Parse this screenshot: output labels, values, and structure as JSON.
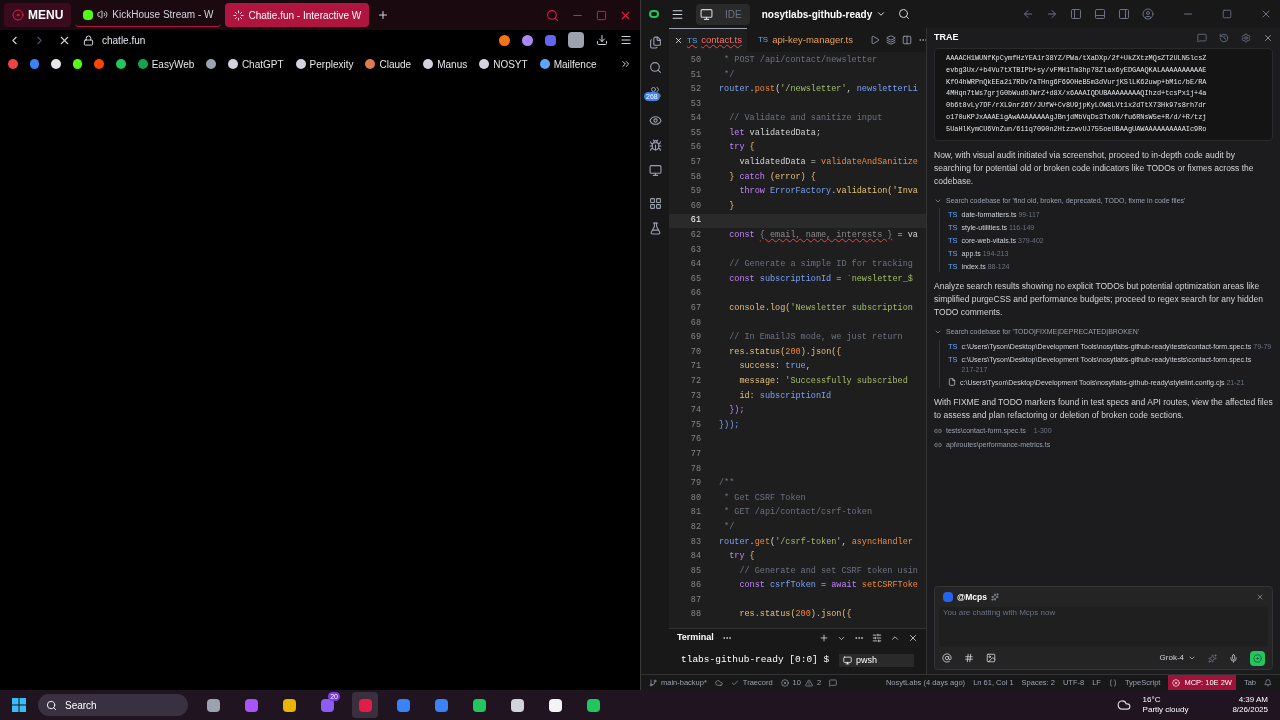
{
  "browser": {
    "menu_label": "MENU",
    "tabs": [
      {
        "title": "KickHouse Stream - W",
        "selected": false,
        "audio": true
      },
      {
        "title": "Chatie.fun - Interactive W",
        "selected": true,
        "audio": false
      }
    ],
    "address": "chatle.fun",
    "bookmarks": [
      {
        "kind": "icon",
        "color": "#ef4444"
      },
      {
        "kind": "icon",
        "color": "#3b82f6"
      },
      {
        "kind": "icon",
        "color": "#e5e7eb"
      },
      {
        "kind": "icon",
        "color": "#53fc18"
      },
      {
        "kind": "icon",
        "color": "#ff4500"
      },
      {
        "kind": "icon",
        "color": "#22c55e"
      },
      {
        "kind": "label",
        "label": "EasyWeb",
        "color": "#16a34a"
      },
      {
        "kind": "icon",
        "color": "#9ca3af"
      },
      {
        "kind": "label",
        "label": "ChatGPT",
        "color": "#d1d5db"
      },
      {
        "kind": "label",
        "label": "Perplexity",
        "color": "#d1d5db"
      },
      {
        "kind": "label",
        "label": "Claude",
        "color": "#e07a4f"
      },
      {
        "kind": "label",
        "label": "Manus",
        "color": "#d1d5db"
      },
      {
        "kind": "label",
        "label": "NOSYT",
        "color": "#d1d5db"
      },
      {
        "kind": "label",
        "label": "Mailfence",
        "color": "#60a5fa"
      }
    ]
  },
  "ide": {
    "mode_label": "IDE",
    "project": "nosytlabs-github-ready",
    "activity_badge": "268",
    "tabs": [
      {
        "badge": "TS",
        "label": "contact.ts",
        "selected": true
      },
      {
        "badge": "TS",
        "label": "api-key-manager.ts",
        "selected": false
      }
    ],
    "code_lines": [
      {
        "number": "50",
        "current": false,
        "tokens": [
          {
            "kind": "comment",
            "t": " * POST /api/contact/newsletter"
          }
        ]
      },
      {
        "number": "51",
        "current": false,
        "tokens": [
          {
            "kind": "comment",
            "t": " */"
          }
        ]
      },
      {
        "number": "52",
        "current": false,
        "tokens": [
          {
            "kind": "variable",
            "t": "router"
          },
          {
            "kind": "plain",
            "t": "."
          },
          {
            "kind": "function",
            "t": "post"
          },
          {
            "kind": "plain",
            "t": "("
          },
          {
            "kind": "string",
            "t": "'/newsletter'"
          },
          {
            "kind": "plain",
            "t": ", "
          },
          {
            "kind": "variable",
            "t": "newsletterLi"
          }
        ]
      },
      {
        "number": "53",
        "current": false
      },
      {
        "number": "54",
        "current": false,
        "tokens": [
          {
            "kind": "comment",
            "t": "  // Validate and sanitize input"
          }
        ]
      },
      {
        "number": "55",
        "current": false,
        "tokens": [
          {
            "kind": "keyword",
            "t": "  let "
          },
          {
            "kind": "plain",
            "t": "validatedData;"
          }
        ]
      },
      {
        "number": "56",
        "current": false,
        "tokens": [
          {
            "kind": "keyword",
            "t": "  try "
          },
          {
            "kind": "punct",
            "t": "{"
          }
        ]
      },
      {
        "number": "57",
        "current": false,
        "tokens": [
          {
            "kind": "plain",
            "t": "    validatedData = "
          },
          {
            "kind": "function",
            "t": "validateAndSanitize"
          }
        ]
      },
      {
        "number": "58",
        "current": false,
        "tokens": [
          {
            "kind": "punct",
            "t": "  } "
          },
          {
            "kind": "keyword",
            "t": "catch "
          },
          {
            "kind": "punct",
            "t": "(error) {"
          }
        ]
      },
      {
        "number": "59",
        "current": false,
        "tokens": [
          {
            "kind": "keyword",
            "t": "    throw "
          },
          {
            "kind": "variable",
            "t": "ErrorFactory"
          },
          {
            "kind": "plain",
            "t": "."
          },
          {
            "kind": "punct",
            "t": "validation('Inva"
          }
        ]
      },
      {
        "number": "60",
        "current": false,
        "tokens": [
          {
            "kind": "punct",
            "t": "  }"
          }
        ]
      },
      {
        "number": "61",
        "current": true
      },
      {
        "number": "62",
        "current": false,
        "tokens": [
          {
            "kind": "keyword",
            "t": "  const "
          },
          {
            "kind": "error",
            "t": "{ email, name, interests }"
          },
          {
            "kind": "plain",
            "t": " = va"
          }
        ]
      },
      {
        "number": "63",
        "current": false
      },
      {
        "number": "64",
        "current": false,
        "tokens": [
          {
            "kind": "comment",
            "t": "  // Generate a simple ID for tracking"
          }
        ]
      },
      {
        "number": "65",
        "current": false,
        "tokens": [
          {
            "kind": "keyword",
            "t": "  const "
          },
          {
            "kind": "variable",
            "t": "subscriptionId"
          },
          {
            "kind": "plain",
            "t": " = "
          },
          {
            "kind": "string",
            "t": "`newsletter_$"
          }
        ]
      },
      {
        "number": "66",
        "current": false
      },
      {
        "number": "67",
        "current": false,
        "tokens": [
          {
            "kind": "punct",
            "t": "  console.log("
          },
          {
            "kind": "string",
            "t": "'Newsletter subscription"
          }
        ]
      },
      {
        "number": "68",
        "current": false
      },
      {
        "number": "69",
        "current": false,
        "tokens": [
          {
            "kind": "comment",
            "t": "  // In EmailJS mode, we just return"
          }
        ]
      },
      {
        "number": "70",
        "current": false,
        "tokens": [
          {
            "kind": "punct",
            "t": "  res.status("
          },
          {
            "kind": "number",
            "t": "200"
          },
          {
            "kind": "punct",
            "t": ").json({"
          }
        ]
      },
      {
        "number": "71",
        "current": false,
        "tokens": [
          {
            "kind": "punct",
            "t": "    success: "
          },
          {
            "kind": "variable",
            "t": "true"
          },
          {
            "kind": "plain",
            "t": ","
          }
        ]
      },
      {
        "number": "72",
        "current": false,
        "tokens": [
          {
            "kind": "punct",
            "t": "    message: "
          },
          {
            "kind": "string",
            "t": "'Successfully subscribed"
          }
        ]
      },
      {
        "number": "73",
        "current": false,
        "tokens": [
          {
            "kind": "punct",
            "t": "    id: "
          },
          {
            "kind": "variable",
            "t": "subscriptionId"
          }
        ]
      },
      {
        "number": "74",
        "current": false,
        "tokens": [
          {
            "kind": "keyword",
            "t": "  });"
          }
        ]
      },
      {
        "number": "75",
        "current": false,
        "tokens": [
          {
            "kind": "variable",
            "t": "}));"
          }
        ]
      },
      {
        "number": "76",
        "current": false
      },
      {
        "number": "77",
        "current": false
      },
      {
        "number": "78",
        "current": false
      },
      {
        "number": "79",
        "current": false,
        "tokens": [
          {
            "kind": "comment",
            "t": "/**"
          }
        ]
      },
      {
        "number": "80",
        "current": false,
        "tokens": [
          {
            "kind": "comment",
            "t": " * Get CSRF Token"
          }
        ]
      },
      {
        "number": "81",
        "current": false,
        "tokens": [
          {
            "kind": "comment",
            "t": " * GET /api/contact/csrf-token"
          }
        ]
      },
      {
        "number": "82",
        "current": false,
        "tokens": [
          {
            "kind": "comment",
            "t": " */"
          }
        ]
      },
      {
        "number": "83",
        "current": false,
        "tokens": [
          {
            "kind": "variable",
            "t": "router"
          },
          {
            "kind": "plain",
            "t": "."
          },
          {
            "kind": "function",
            "t": "get"
          },
          {
            "kind": "plain",
            "t": "("
          },
          {
            "kind": "string",
            "t": "'/csrf-token'"
          },
          {
            "kind": "plain",
            "t": ", "
          },
          {
            "kind": "function",
            "t": "asyncHandler"
          }
        ]
      },
      {
        "number": "84",
        "current": false,
        "tokens": [
          {
            "kind": "keyword",
            "t": "  try "
          },
          {
            "kind": "punct",
            "t": "{"
          }
        ]
      },
      {
        "number": "85",
        "current": false,
        "tokens": [
          {
            "kind": "comment",
            "t": "    // Generate and set CSRF token usin"
          }
        ]
      },
      {
        "number": "86",
        "current": false,
        "tokens": [
          {
            "kind": "keyword",
            "t": "    const "
          },
          {
            "kind": "variable",
            "t": "csrfToken"
          },
          {
            "kind": "plain",
            "t": " = "
          },
          {
            "kind": "keyword",
            "t": "await "
          },
          {
            "kind": "function",
            "t": "setCSRFToke"
          }
        ]
      },
      {
        "number": "87",
        "current": false
      },
      {
        "number": "88",
        "current": false,
        "tokens": [
          {
            "kind": "punct",
            "t": "    res.status("
          },
          {
            "kind": "number",
            "t": "200"
          },
          {
            "kind": "punct",
            "t": ").json({"
          }
        ]
      }
    ],
    "terminal": {
      "tab": "Terminal",
      "prompt": "tlabs-github-ready [0:0] $",
      "sessions": [
        {
          "label": "pwsh",
          "selected": true
        }
      ]
    },
    "status_bar": {
      "branch": "main-backup*",
      "traecord": "Traecord",
      "errors": "10",
      "warnings": "2",
      "blame": "NosytLabs (4 days ago)",
      "position": "Ln 61, Col 1",
      "spaces": "Spaces: 2",
      "encoding": "UTF-8",
      "eol": "LF",
      "language": "TypeScript",
      "mcp": "MCP: 10E 2W",
      "tab": "Tab"
    }
  },
  "assistant": {
    "title": "TRAE",
    "code_block": [
      "AAAACH1WUNfKpCymfHzYEA1r38YZ/PWa/tXaDXp/2f+UkZXtzMQsZT2ULN5lcsZ",
      "evbg3Ux/+b4Vu7tXTBIPb+sy/vFMH1Tm3hp78Zlax6yEDGAAQKALAAAAAAAAAAE",
      "KfO4hWRPnQkEEa2i7RDv7aTHng6F69OHeB5m3dVurjKSlLK62uwp+bM1c/bE/RA",
      "4MHqn7tWs7grjG0bWudOJWrZ+d8X/x6AAAIQDUBAAAAAAAAQIhzd+tcsPx1j+4a",
      "0b6t8vLy7DF/rXL9nr26Y/JUfW+Cv8U9jpKyLOW8LVt1x2dTtX73Hk97s8rh7dr",
      "o170uKPJxAAAEigAwAAAAAAAAgJBnjdMbVqDs3TxON/fu6RNsW5e+R/d/+R/tzj",
      "5UaHlKymCU6VnZun/611q7090n2HtzzwvUJ755oeUBAAgUAWAAAAAAAAAAIc9Ro"
    ],
    "messages": [
      {
        "kind": "text",
        "text": "Now, with visual audit initiated via screenshot, proceed to in-depth code audit by searching for potential old or broken code indicators like TODOs or fixmes across the codebase."
      },
      {
        "kind": "search",
        "expanded": true,
        "query": "Search codebase for 'find old, broken, deprecated, TODO, fixme in code files'",
        "results": [
          {
            "kind": "ts",
            "badge": "TS",
            "name": "date-formatters.ts",
            "range": "99-117"
          },
          {
            "kind": "ts",
            "badge": "TS",
            "name": "style-utilities.ts",
            "range": "116-149"
          },
          {
            "kind": "ts",
            "badge": "TS",
            "name": "core-web-vitals.ts",
            "range": "379-402"
          },
          {
            "kind": "ts",
            "badge": "TS",
            "name": "app.ts",
            "range": "194-213"
          },
          {
            "kind": "ts",
            "badge": "TS",
            "name": "index.ts",
            "range": "88-124"
          }
        ]
      },
      {
        "kind": "text",
        "text": "Analyze search results showing no explicit TODOs but potential optimization areas like simplified purgeCSS and performance budgets; proceed to regex search for any hidden TODO comments."
      },
      {
        "kind": "search",
        "expanded": true,
        "query": "Search codebase for 'TODO|FIXME|DEPRECATED|BROKEN'",
        "results": [
          {
            "kind": "ts",
            "badge": "TS",
            "name": "c:\\Users\\Tyson\\Desktop\\Development Tools\\nosytlabs-github-ready\\tests\\contact-form.spec.ts",
            "range": "79-79"
          },
          {
            "kind": "ts",
            "badge": "TS",
            "name": "c:\\Users\\Tyson\\Desktop\\Development Tools\\nosytlabs-github-ready\\tests\\contact-form.spec.ts",
            "range": "217-217"
          },
          {
            "kind": "file",
            "name": "c:\\Users\\Tyson\\Desktop\\Development Tools\\nosytlabs-github-ready\\stylelint.config.cjs",
            "range": "21-21"
          }
        ]
      },
      {
        "kind": "text",
        "text": "With FIXME and TODO markers found in test specs and API routes, view the affected files to assess and plan refactoring or deletion of broken code sections."
      },
      {
        "kind": "view",
        "name": "tests\\contact-form.spec.ts",
        "range": "1-300"
      },
      {
        "kind": "view",
        "name": "api\\routes\\performance-metrics.ts"
      }
    ],
    "chat": {
      "agent": "@Mcps",
      "placeholder": "You are chatting with Mcps now",
      "model": "Grok-4"
    }
  },
  "taskbar": {
    "search": "Search",
    "apps": [
      {
        "color": "#9ca3af",
        "selected": false
      },
      {
        "color": "#a855f7",
        "selected": false
      },
      {
        "color": "#eab308",
        "selected": false
      },
      {
        "color": "#8b5cf6",
        "selected": false,
        "badge": "20"
      },
      {
        "color": "#e11d48",
        "selected": true
      },
      {
        "color": "#3b82f6",
        "selected": false
      },
      {
        "color": "#3b82f6",
        "selected": false
      },
      {
        "color": "#22c55e",
        "selected": false
      },
      {
        "color": "#d1d5db",
        "selected": false
      },
      {
        "color": "#f3f4f6",
        "selected": false
      },
      {
        "color": "#22c55e",
        "selected": false
      }
    ],
    "temperature": "16°C",
    "weather": "Partly cloudy",
    "time": "4:39 AM",
    "date": "8/26/2025"
  }
}
